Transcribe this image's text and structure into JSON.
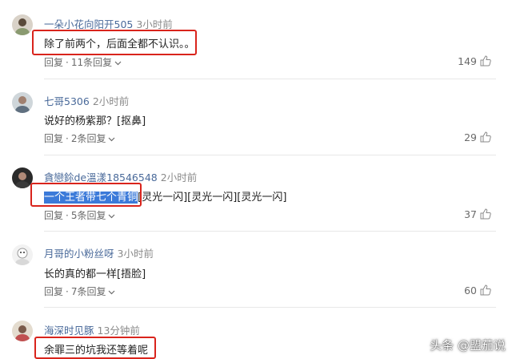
{
  "comments": [
    {
      "user": "一朵小花向阳开505",
      "time": "3小时前",
      "text": "除了前两个，后面全都不认识。。",
      "reply_label": "回复",
      "reply_count": "11条回复",
      "likes": "149"
    },
    {
      "user": "七哥5306",
      "time": "2小时前",
      "text": "说好的杨紫那？[抠鼻]",
      "reply_label": "回复",
      "reply_count": "2条回复",
      "likes": "29"
    },
    {
      "user": "貪戀鉩de溫漾18546548",
      "time": "2小时前",
      "text_highlight": "一个王者带七个青铜",
      "text_rest": "[灵光一闪][灵光一闪][灵光一闪]",
      "reply_label": "回复",
      "reply_count": "5条回复",
      "likes": "37"
    },
    {
      "user": "月哥的小粉丝呀",
      "time": "3小时前",
      "text": "长的真的都一样[捂脸]",
      "reply_label": "回复",
      "reply_count": "7条回复",
      "likes": "60"
    },
    {
      "user": "海深时见豚",
      "time": "13分钟前",
      "text": "余罪三的坑我还等着呢"
    }
  ],
  "watermark": "头条 @盟茄说",
  "colors": {
    "username": "#4a6a9a",
    "highlight_box": "#d9241c",
    "selection": "#3b7ad9"
  }
}
